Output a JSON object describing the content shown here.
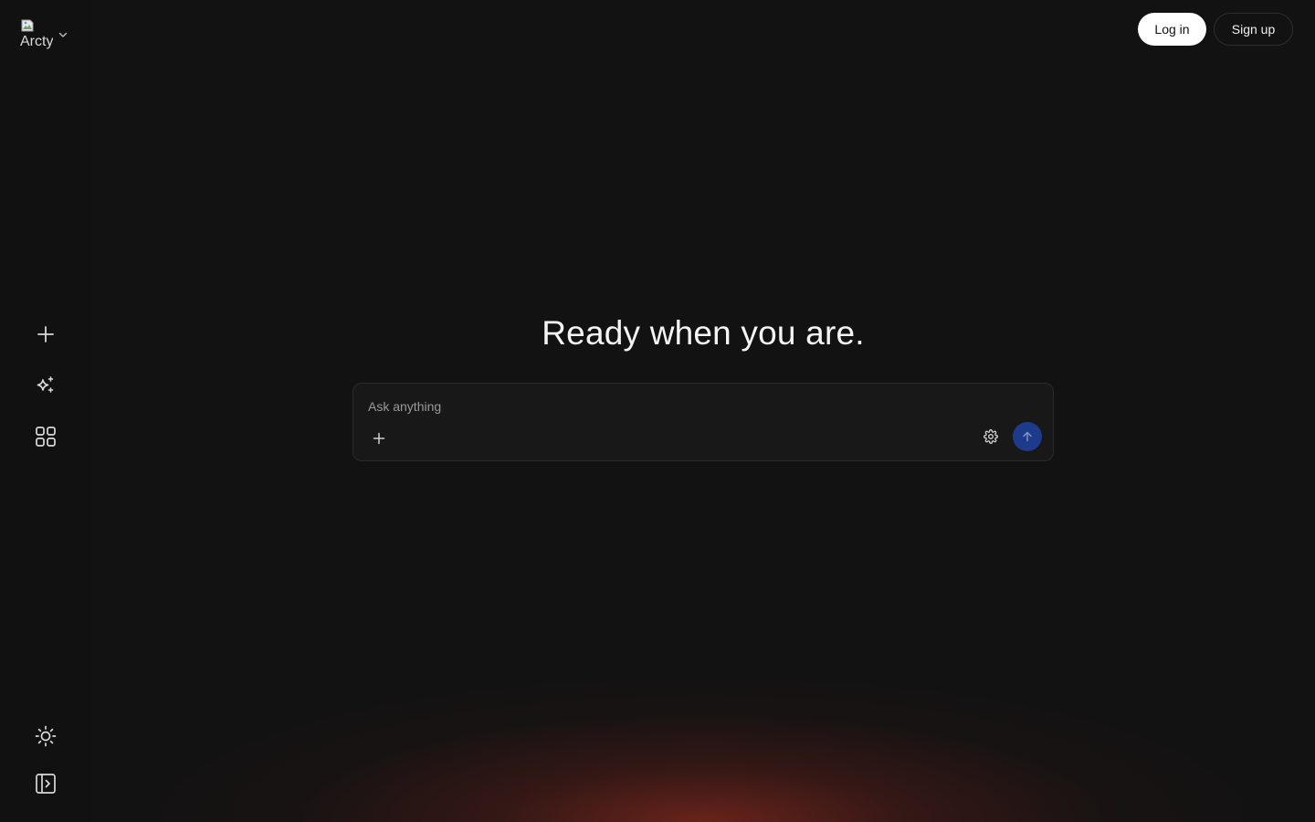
{
  "brand": {
    "logo_alt": "Arcty",
    "chevron_icon": "chevron-down-icon"
  },
  "header": {
    "login_label": "Log in",
    "signup_label": "Sign up"
  },
  "sidebar": {
    "items": [
      {
        "icon": "plus-icon",
        "name": "new-chat"
      },
      {
        "icon": "sparkles-icon",
        "name": "explore"
      },
      {
        "icon": "grid-icon",
        "name": "apps"
      }
    ],
    "bottom": [
      {
        "icon": "sun-icon",
        "name": "theme-toggle"
      },
      {
        "icon": "sidebar-panel-icon",
        "name": "toggle-sidebar"
      }
    ]
  },
  "main": {
    "title": "Ready when you are.",
    "composer": {
      "placeholder": "Ask anything",
      "value": ""
    }
  },
  "colors": {
    "background": "#121212",
    "send_button": "#1e3a8a",
    "glow": "#7a2a1e"
  }
}
